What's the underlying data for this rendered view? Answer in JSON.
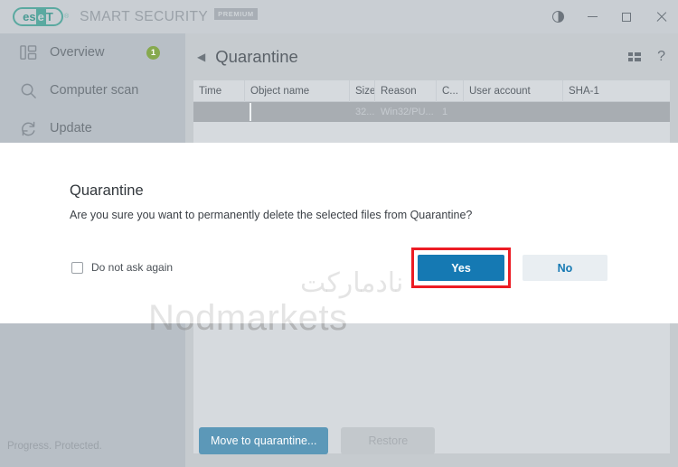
{
  "window": {
    "brand_eset": "eset",
    "brand_e": "es",
    "brand_mid": "e",
    "brand_t": "T",
    "trademark": "®",
    "product_name": "SMART SECURITY",
    "edition_badge": "PREMIUM",
    "controls": {
      "theme_toggle": "contrast-toggle",
      "minimize": "minimize",
      "maximize": "maximize",
      "close": "close"
    }
  },
  "sidebar": {
    "items": [
      {
        "label": "Overview",
        "icon": "dashboard-icon",
        "badge": "1"
      },
      {
        "label": "Computer scan",
        "icon": "search-icon",
        "badge": ""
      },
      {
        "label": "Update",
        "icon": "refresh-icon",
        "badge": ""
      }
    ]
  },
  "header": {
    "back": "◀",
    "title": "Quarantine",
    "layout_icon": "list-layout-icon",
    "help_icon": "?"
  },
  "table": {
    "columns": [
      {
        "label": "Time",
        "width": 57
      },
      {
        "label": "Object name",
        "width": 116
      },
      {
        "label": "Size",
        "width": 28
      },
      {
        "label": "Reason",
        "width": 68
      },
      {
        "label": "C...",
        "width": 30
      },
      {
        "label": "User account",
        "width": 110
      },
      {
        "label": "SHA-1",
        "width": 118
      }
    ],
    "rows": [
      {
        "time": "",
        "object_name": "",
        "size": "32...",
        "reason": "Win32/PU...",
        "c": "1",
        "user_account": "",
        "sha1": "",
        "selected": true
      }
    ]
  },
  "footer": {
    "status": "Progress. Protected.",
    "move_button": "Move to quarantine...",
    "restore_button": "Restore"
  },
  "dialog": {
    "title": "Quarantine",
    "message": "Are you sure you want to permanently delete the selected files from Quarantine?",
    "checkbox_label": "Do not ask again",
    "checkbox_checked": false,
    "confirm_label": "Yes",
    "cancel_label": "No"
  },
  "annotation": {
    "highlight_color": "#ec1c24",
    "target": "Yes"
  },
  "watermark": {
    "farsi": "نادمارکت",
    "english": "Nodmarkets"
  },
  "colors": {
    "accent_blue": "#1579b3",
    "teal_button": "#5c98b8",
    "badge_green": "#86a94e",
    "eset_teal": "#5aa9a0"
  }
}
